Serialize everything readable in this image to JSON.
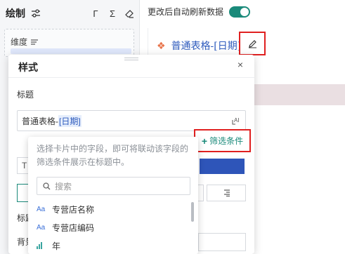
{
  "left_panel": {
    "title": "绘制",
    "tools": [
      "Γ",
      "Σ"
    ],
    "dimension_label": "维度"
  },
  "auto_refresh": {
    "label": "更改后自动刷新数据",
    "enabled": true
  },
  "card": {
    "title": "普通表格-[日期]"
  },
  "modal": {
    "title": "样式",
    "close": "×",
    "section_title": "标题",
    "title_input_prefix": "普通表格-",
    "title_input_field": "[日期]",
    "filter_button_label": "筛选条件",
    "filter_plus": "+",
    "partial_left_1": "T",
    "partial_left_3": "标题",
    "partial_left_4": "背景"
  },
  "dropdown": {
    "hint": "选择卡片中的字段，即可将联动该字段的筛选条件展示在标题中。",
    "search_placeholder": "搜索",
    "items": [
      {
        "icon": "Aa",
        "label": "专营店名称"
      },
      {
        "icon": "Aa",
        "label": "专营店编码"
      },
      {
        "icon": "bar",
        "label": "年"
      }
    ]
  },
  "colors": {
    "accent_teal": "#1a8a7a",
    "link_blue": "#2e5bbd",
    "highlight_red": "#e02020",
    "band_pink": "#eadfe2"
  }
}
